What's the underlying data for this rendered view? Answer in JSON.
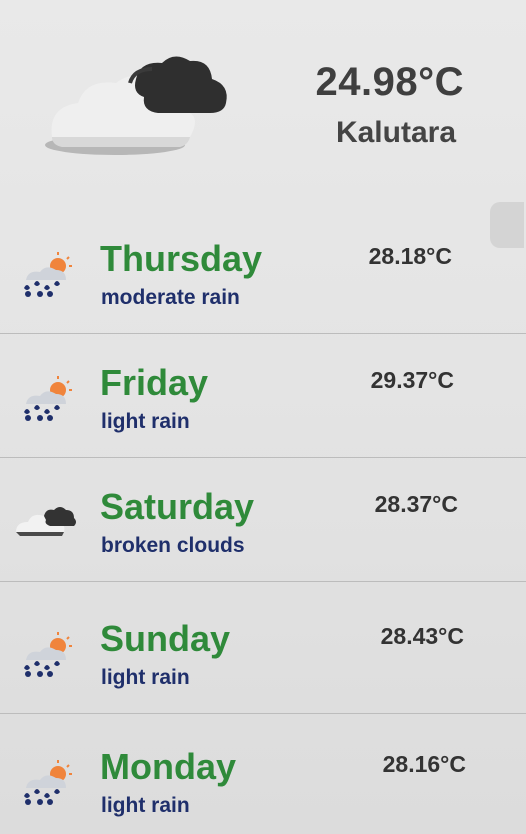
{
  "current": {
    "temperature": "24.98°C",
    "city": "Kalutara",
    "icon": "broken-clouds-large-icon"
  },
  "forecast": [
    {
      "day": "Thursday",
      "description": "moderate rain",
      "temperature": "28.18°C",
      "icon": "rain-sun-icon"
    },
    {
      "day": "Friday",
      "description": "light rain",
      "temperature": "29.37°C",
      "icon": "rain-sun-icon"
    },
    {
      "day": "Saturday",
      "description": "broken clouds",
      "temperature": "28.37°C",
      "icon": "broken-clouds-icon"
    },
    {
      "day": "Sunday",
      "description": "light rain",
      "temperature": "28.43°C",
      "icon": "rain-sun-icon"
    },
    {
      "day": "Monday",
      "description": "light rain",
      "temperature": "28.16°C",
      "icon": "rain-sun-icon"
    }
  ],
  "colors": {
    "day_name": "#2f8a3a",
    "description": "#1f2f6b",
    "temperature": "#333333",
    "rain_drop": "#1f2f6b",
    "sun": "#f0843c"
  }
}
